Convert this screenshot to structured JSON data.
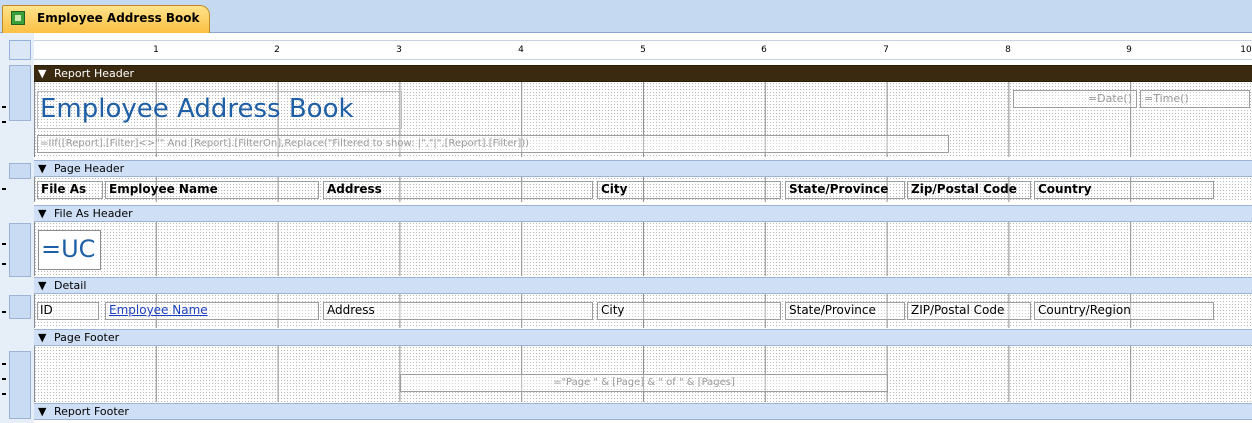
{
  "tab": {
    "title": "Employee Address Book",
    "icon": "report-icon"
  },
  "ruler": {
    "marks": [
      "1",
      "2",
      "3",
      "4",
      "5",
      "6",
      "7",
      "8",
      "9",
      "10"
    ]
  },
  "sections": {
    "report_header": "Report Header",
    "page_header": "Page Header",
    "file_as_header": "File As Header",
    "detail": "Detail",
    "page_footer": "Page Footer",
    "report_footer": "Report Footer"
  },
  "report_header": {
    "title": "Employee Address Book",
    "date_expr": "=Date()",
    "time_expr": "=Time()",
    "filter_expr": "=IIf([Report].[Filter]<>\"\" And [Report].[FilterOn],Replace(\"Filtered to show: |\",\"|\",[Report].[Filter]))"
  },
  "page_header": {
    "labels": [
      "File As",
      "Employee Name",
      "Address",
      "City",
      "State/Province",
      "Zip/Postal Code",
      "Country"
    ]
  },
  "file_as_header": {
    "group_expr": "=UC"
  },
  "detail": {
    "fields": [
      "ID",
      "Employee Name",
      "Address",
      "City",
      "State/Province",
      "ZIP/Postal Code",
      "Country/Region"
    ]
  },
  "page_footer": {
    "page_expr": "=\"Page \" & [Page] & \" of \" & [Pages]"
  },
  "colors": {
    "section_bar": "#cfe0f6",
    "report_bar": "#3a2a10",
    "tab_active": "#fcbf43",
    "title_text": "#1f5fa5",
    "hyperlink": "#1a3fbf"
  }
}
